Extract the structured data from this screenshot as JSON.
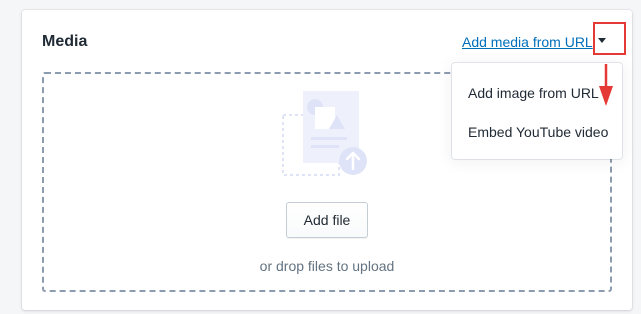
{
  "media": {
    "title": "Media",
    "add_media_link": "Add media from URL",
    "add_file_label": "Add file",
    "drop_hint": "or drop files to upload"
  },
  "dropdown": {
    "items": [
      {
        "label": "Add image from URL"
      },
      {
        "label": "Embed YouTube video"
      }
    ]
  },
  "icons": {
    "caret": "caret-down-icon",
    "illustration": "file-upload-illustration",
    "upload_arrow": "upload-arrow-icon",
    "annotation_arrow": "red-arrow-annotation"
  },
  "colors": {
    "link": "#006fbb",
    "highlight": "#e53935",
    "border_dashed": "#8c9cb0",
    "illustration": "#dfe3f8"
  }
}
